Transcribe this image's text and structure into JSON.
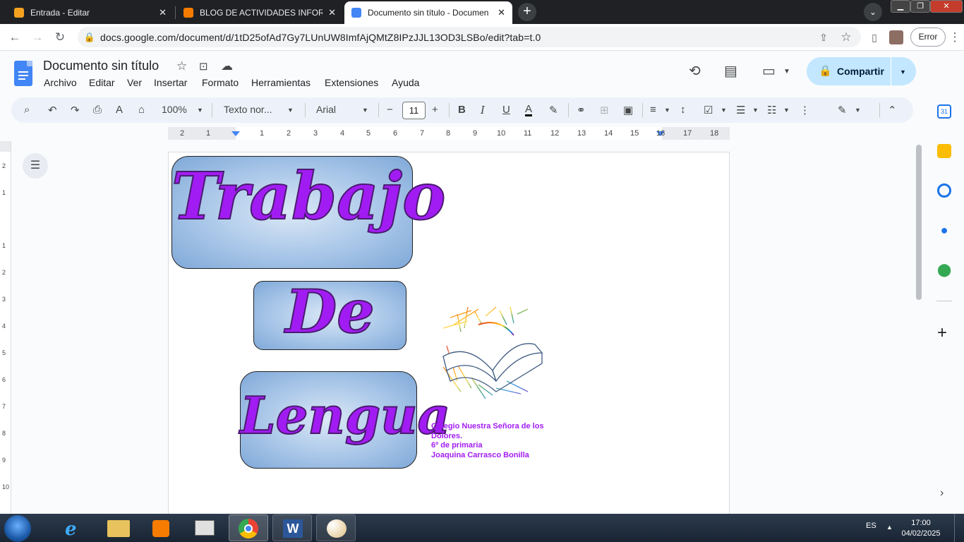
{
  "browser": {
    "tabs": [
      {
        "title": "Entrada - Editar",
        "favicon_color": "#f4a21f",
        "active": false
      },
      {
        "title": "BLOG DE ACTIVIDADES INFORMA",
        "favicon_color": "#f57c00",
        "active": false
      },
      {
        "title": "Documento sin título - Documen",
        "favicon_color": "#4285f4",
        "active": true
      }
    ],
    "new_tab_icon": "+",
    "url": "docs.google.com/document/d/1tD25ofAd7Gy7LUnUW8ImfAjQMtZ8IPzJJL13OD3LSBo/edit?tab=t.0",
    "error_label": "Error"
  },
  "docs": {
    "title": "Documento sin título",
    "menu": [
      "Archivo",
      "Editar",
      "Ver",
      "Insertar",
      "Formato",
      "Herramientas",
      "Extensiones",
      "Ayuda"
    ],
    "share_label": "Compartir",
    "toolbar": {
      "zoom": "100%",
      "style": "Texto nor...",
      "font": "Arial",
      "font_size": "11"
    },
    "ruler_numbers": [
      "2",
      "1",
      "1",
      "2",
      "3",
      "4",
      "5",
      "6",
      "7",
      "8",
      "9",
      "10",
      "11",
      "12",
      "13",
      "14",
      "15",
      "16",
      "17",
      "18"
    ],
    "vruler_numbers": [
      "2",
      "1",
      "1",
      "2",
      "3",
      "4",
      "5",
      "6",
      "7",
      "8",
      "9",
      "10"
    ]
  },
  "document": {
    "word1": "Trabajo",
    "word2": "De",
    "word3": "Lengua",
    "school_lines": [
      "Colegio Nuestra Señora de los",
      "Dolores.",
      "6º de  primaria",
      "Joaquina Carrasco Bonilla"
    ],
    "accent_color": "#a11cf2"
  },
  "taskbar": {
    "language": "ES",
    "time": "17:00",
    "date": "04/02/2025"
  }
}
